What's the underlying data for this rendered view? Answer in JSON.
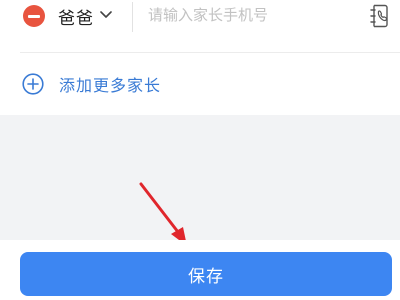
{
  "parent_row": {
    "relation_label": "爸爸",
    "phone_placeholder": "请输入家长手机号",
    "phone_value": "",
    "remove_icon": "minus-circle-icon",
    "contacts_icon": "phone-book-icon"
  },
  "add_more": {
    "label": "添加更多家长",
    "icon": "plus-circle-icon"
  },
  "footer": {
    "save_label": "保存"
  },
  "colors": {
    "page_background": "#f2f3f5",
    "remove_red": "#e8543f",
    "link_blue": "#3a7bd5",
    "primary_button": "#3d86f2",
    "annotation_arrow": "#e0262c"
  }
}
